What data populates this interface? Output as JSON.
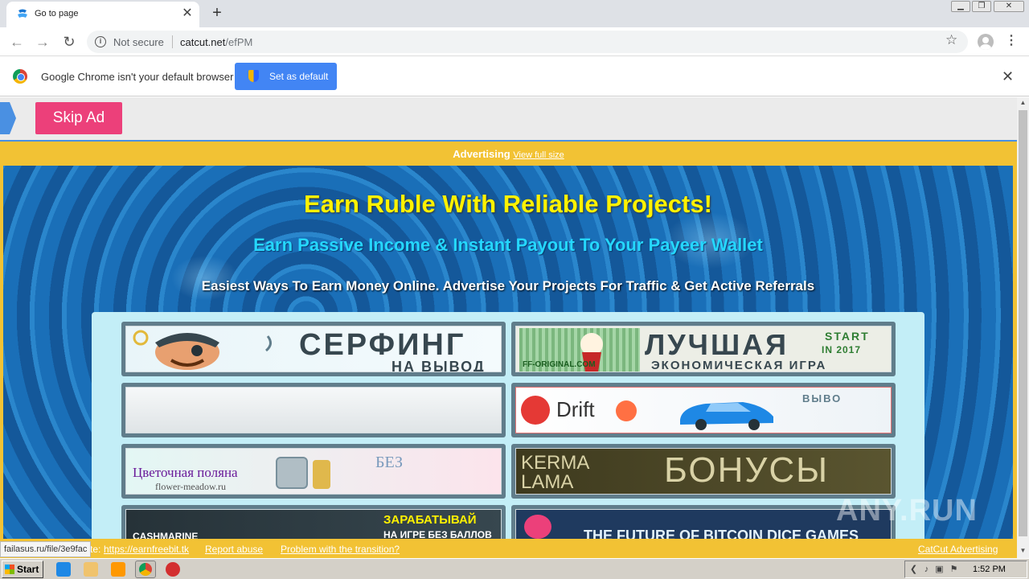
{
  "browser": {
    "tab": {
      "title": "Go to page",
      "close": "✕"
    },
    "new_tab": "+",
    "window_buttons": {
      "minimize": "▁",
      "restore": "❐",
      "close": "✕"
    },
    "omnibox": {
      "security_label": "Not secure",
      "host": "catcut.net",
      "path": "/efPM"
    }
  },
  "infobar": {
    "message": "Google Chrome isn't your default browser",
    "button": "Set as default",
    "close": "✕"
  },
  "page": {
    "skip_ad": "Skip Ad",
    "ad_header": {
      "label": "Advertising",
      "link": "View full size"
    },
    "headline": "Earn Ruble With Reliable Projects!",
    "subheadline": "Earn Passive Income & Instant Payout To Your Payeer Wallet",
    "tagline": "Easiest Ways To Earn Money Online. Advertise Your Projects For Traffic & Get Active Referrals",
    "banners": [
      {
        "big": "СЕРФИНГ",
        "small": "НА ВЫВОД"
      },
      {
        "big": "ЛУЧШАЯ",
        "small": "ЭКОНОМИЧЕСКАЯ ИГРА",
        "tag_a": "START",
        "tag_b": "IN 2017",
        "site": "FF-ORIGINAL.COM"
      },
      {
        "big": ""
      },
      {
        "big": "Drift",
        "small": "ВЫВО"
      },
      {
        "big": "Цветочная поляна",
        "small": "flower-meadow.ru",
        "extra": "БЕЗ"
      },
      {
        "big": "БОНУСЫ",
        "small": "KERMA LAMA"
      },
      {
        "big": "ЗАРАБАТЫВАЙ",
        "small": "НА ИГРЕ БЕЗ БАЛЛОВ",
        "brand": "CASHMARINE"
      },
      {
        "big": "THE FUTURE OF BITCOIN DICE GAMES"
      }
    ],
    "footer": {
      "site_prefix": "te:",
      "site_link": "https://earnfreebit.tk",
      "report": "Report abuse",
      "problem": "Problem with the transition?",
      "catcut": "CatCut Advertising"
    },
    "status_url": "failasus.ru/file/3e9fac"
  },
  "watermark": "ANY.RUN",
  "taskbar": {
    "start": "Start",
    "clock": "1:52 PM"
  },
  "colors": {
    "accent_blue": "#4285f4",
    "skip_ad": "#ec407a",
    "ad_frame": "#f2c234",
    "headline": "#fff200",
    "subheadline": "#25d7ff"
  }
}
